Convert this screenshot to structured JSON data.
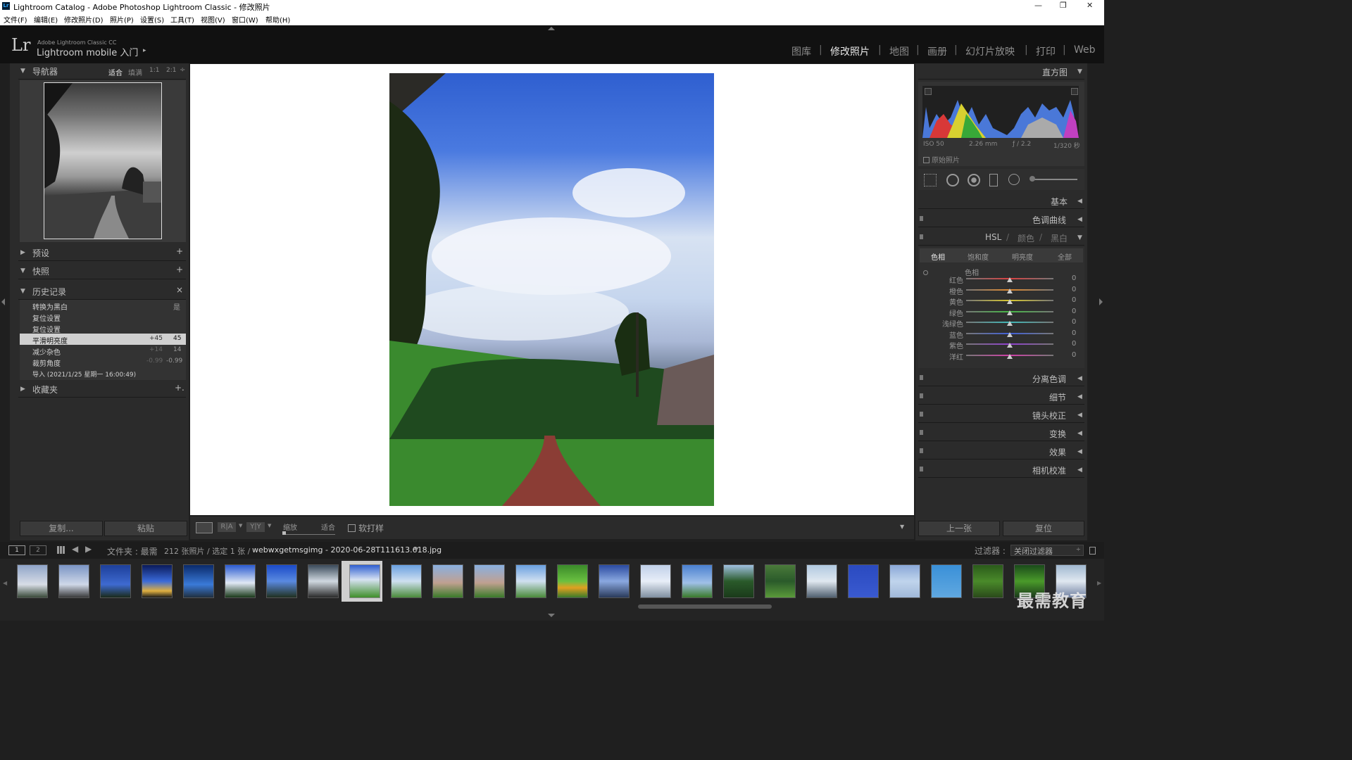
{
  "window": {
    "title": "Lightroom Catalog - Adobe Photoshop Lightroom Classic - 修改照片",
    "app_icon": "Lr",
    "controls": [
      "—",
      "❐",
      "✕"
    ]
  },
  "menu": [
    "文件(F)",
    "编辑(E)",
    "修改照片(D)",
    "照片(P)",
    "设置(S)",
    "工具(T)",
    "视图(V)",
    "窗口(W)",
    "帮助(H)"
  ],
  "header": {
    "logo": "Lr",
    "product": "Adobe Lightroom Classic CC",
    "identity": "Lightroom mobile 入门",
    "arrow": "▸",
    "modules": [
      "图库",
      "修改照片",
      "地图",
      "画册",
      "幻灯片放映",
      "打印",
      "Web"
    ],
    "active_module": "修改照片",
    "separator": "|"
  },
  "left": {
    "navigator": {
      "title": "导航器",
      "zoom_options": [
        "适合",
        "填满",
        "1:1",
        "2:1"
      ],
      "active_zoom": "适合",
      "zoom_arrows": "÷"
    },
    "presets": {
      "title": "预设",
      "action": "+"
    },
    "snapshots": {
      "title": "快照",
      "action": "+"
    },
    "history": {
      "title": "历史记录",
      "action": "×",
      "items": [
        {
          "label": "转换为黑白",
          "a": "",
          "b": "是"
        },
        {
          "label": "复位设置",
          "a": "",
          "b": ""
        },
        {
          "label": "复位设置",
          "a": "",
          "b": ""
        },
        {
          "label": "平滑明亮度",
          "a": "+45",
          "b": "45"
        },
        {
          "label": "减少杂色",
          "a": "+14",
          "b": "14"
        },
        {
          "label": "裁剪角度",
          "a": "-0.99",
          "b": "-0.99"
        },
        {
          "label": "导入 (2021/1/25 星期一 16:00:49)",
          "a": "",
          "b": ""
        }
      ],
      "selected_index": 3
    },
    "collections": {
      "title": "收藏夹",
      "action": "+."
    },
    "copy_button": "复制...",
    "paste_button": "粘贴"
  },
  "toolbar": {
    "zoom_label": "缩放",
    "zoom_value": "适合",
    "softproof_label": "软打样",
    "ry": "R|A",
    "yy": "Y|Y",
    "menu_arrow": "▼"
  },
  "right": {
    "histogram": {
      "title": "直方图",
      "iso": "ISO 50",
      "focal": "2.26 mm",
      "aperture": "ƒ / 2.2",
      "shutter": "1/320 秒",
      "original_label": "原始照片"
    },
    "sections": [
      "基本",
      "色调曲线"
    ],
    "hsl": {
      "title": "HSL",
      "slash": "/",
      "color": "颜色",
      "bw": "黑白",
      "tabs": [
        "色相",
        "饱和度",
        "明亮度",
        "全部"
      ],
      "active_tab": "色相",
      "group": "色相",
      "channels": [
        {
          "name": "红色",
          "value": "0",
          "color": "#d94040"
        },
        {
          "name": "橙色",
          "value": "0",
          "color": "#e08a30"
        },
        {
          "name": "黄色",
          "value": "0",
          "color": "#d8c830"
        },
        {
          "name": "绿色",
          "value": "0",
          "color": "#45b845"
        },
        {
          "name": "浅绿色",
          "value": "0",
          "color": "#40b8b8"
        },
        {
          "name": "蓝色",
          "value": "0",
          "color": "#4060d8"
        },
        {
          "name": "紫色",
          "value": "0",
          "color": "#9040d0"
        },
        {
          "name": "洋红",
          "value": "0",
          "color": "#d040a8"
        }
      ]
    },
    "more_sections": [
      "分离色调",
      "细节",
      "镜头校正",
      "变换",
      "效果",
      "相机校准"
    ],
    "prev_button": "上一张",
    "reset_button": "复位"
  },
  "filmstrip_bar": {
    "screen1": "1",
    "screen2": "2",
    "folder_label": "文件夹 : 最需",
    "count": "212 张照片 / 选定 1 张 /",
    "filename": "webwxgetmsgimg - 2020-06-28T111613.618.jpg",
    "filter_label": "过滤器 :",
    "filter_value": "关闭过滤器"
  },
  "watermark": "最需教育",
  "colors": {
    "accent": "#e8e8e8",
    "panel": "#2b2b2b",
    "background": "#1f1f1f",
    "film_selected": "#d6d6d6"
  }
}
